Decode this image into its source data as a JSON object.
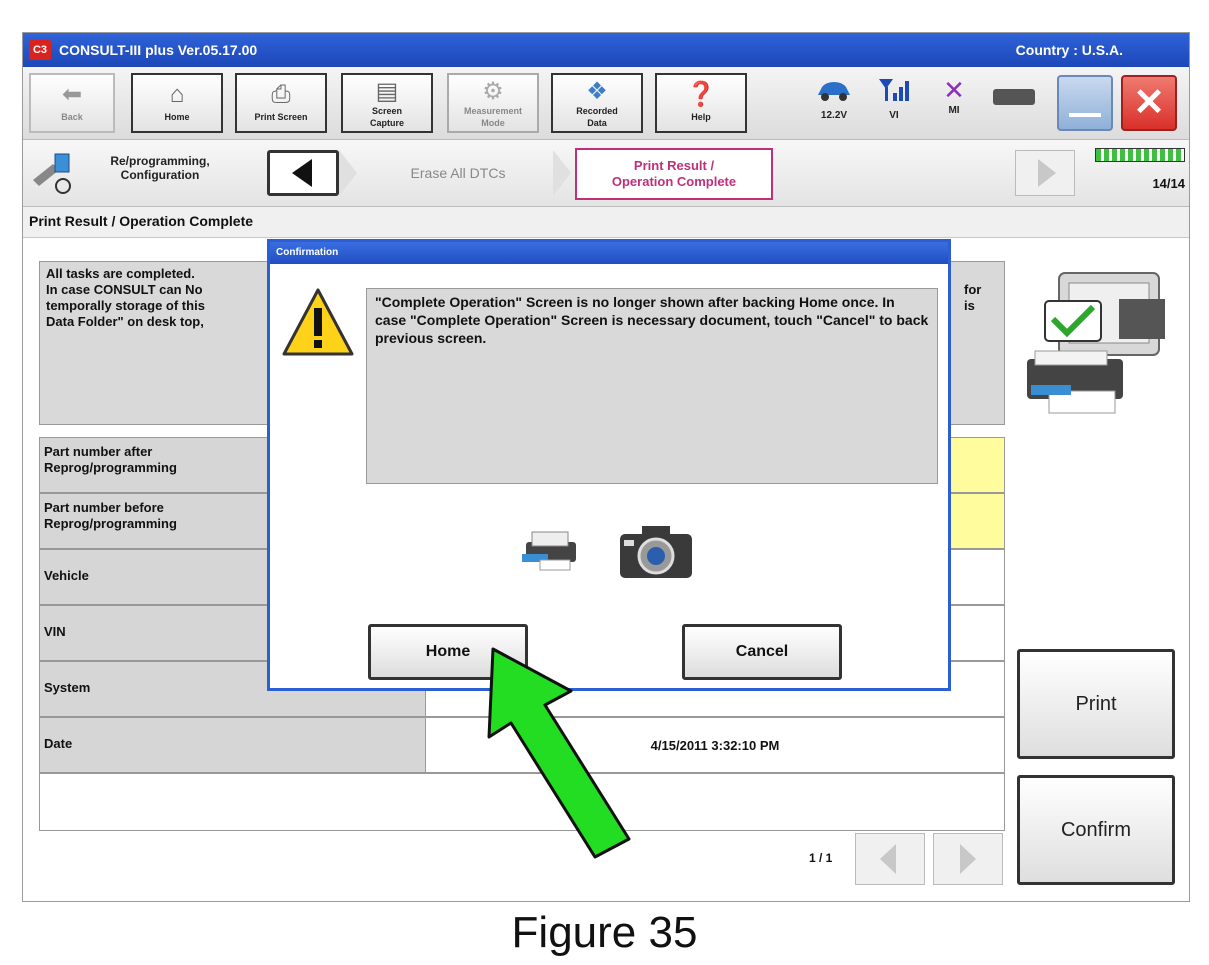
{
  "app": {
    "title": "CONSULT-III plus  Ver.05.17.00",
    "country": "Country : U.S.A.",
    "logo_text": "C3"
  },
  "toolbar": {
    "back": "Back",
    "home": "Home",
    "print_screen": "Print Screen",
    "screen_capture_1": "Screen",
    "screen_capture_2": "Capture",
    "measurement_1": "Measurement",
    "measurement_2": "Mode",
    "recorded_1": "Recorded",
    "recorded_2": "Data",
    "help": "Help",
    "voltage": "12.2V",
    "vi": "VI",
    "mi": "MI"
  },
  "nav": {
    "crumb_1": "Re/programming,",
    "crumb_2": "Configuration",
    "step_prev": "Erase All DTCs",
    "step_current_1": "Print Result /",
    "step_current_2": "Operation Complete",
    "progress": "14/14"
  },
  "section_title": "Print Result / Operation Complete",
  "info_text": {
    "line1": "All tasks are completed.",
    "line2": "In case CONSULT can No",
    "line3": "temporally storage of this",
    "line4": "Data Folder\" on desk top,",
    "right1": "for",
    "right2": "is"
  },
  "rows": [
    {
      "label_1": "Part number after",
      "label_2": "Reprog/programming",
      "value": ""
    },
    {
      "label_1": "Part number before",
      "label_2": "Reprog/programming",
      "value": ""
    },
    {
      "label_1": "Vehicle",
      "label_2": "",
      "value": ""
    },
    {
      "label_1": "VIN",
      "label_2": "",
      "value": ""
    },
    {
      "label_1": "System",
      "label_2": "",
      "value": ""
    },
    {
      "label_1": "Date",
      "label_2": "",
      "value": "4/15/2011 3:32:10 PM"
    }
  ],
  "pager": "1 / 1",
  "side_buttons": {
    "print": "Print",
    "confirm": "Confirm"
  },
  "dialog": {
    "title": "Confirmation",
    "message": "\"Complete Operation\" Screen is no longer shown after backing Home once. In case \"Complete Operation\" Screen is necessary document, touch \"Cancel\" to back previous screen.",
    "home": "Home",
    "cancel": "Cancel"
  },
  "caption": "Figure 35",
  "colors": {
    "titlebar": "#2455cc",
    "highlight_yellow": "#fffc9e",
    "arrow_green": "#22dd22",
    "close_red": "#e0403a",
    "accent_pink": "#c0307a"
  }
}
